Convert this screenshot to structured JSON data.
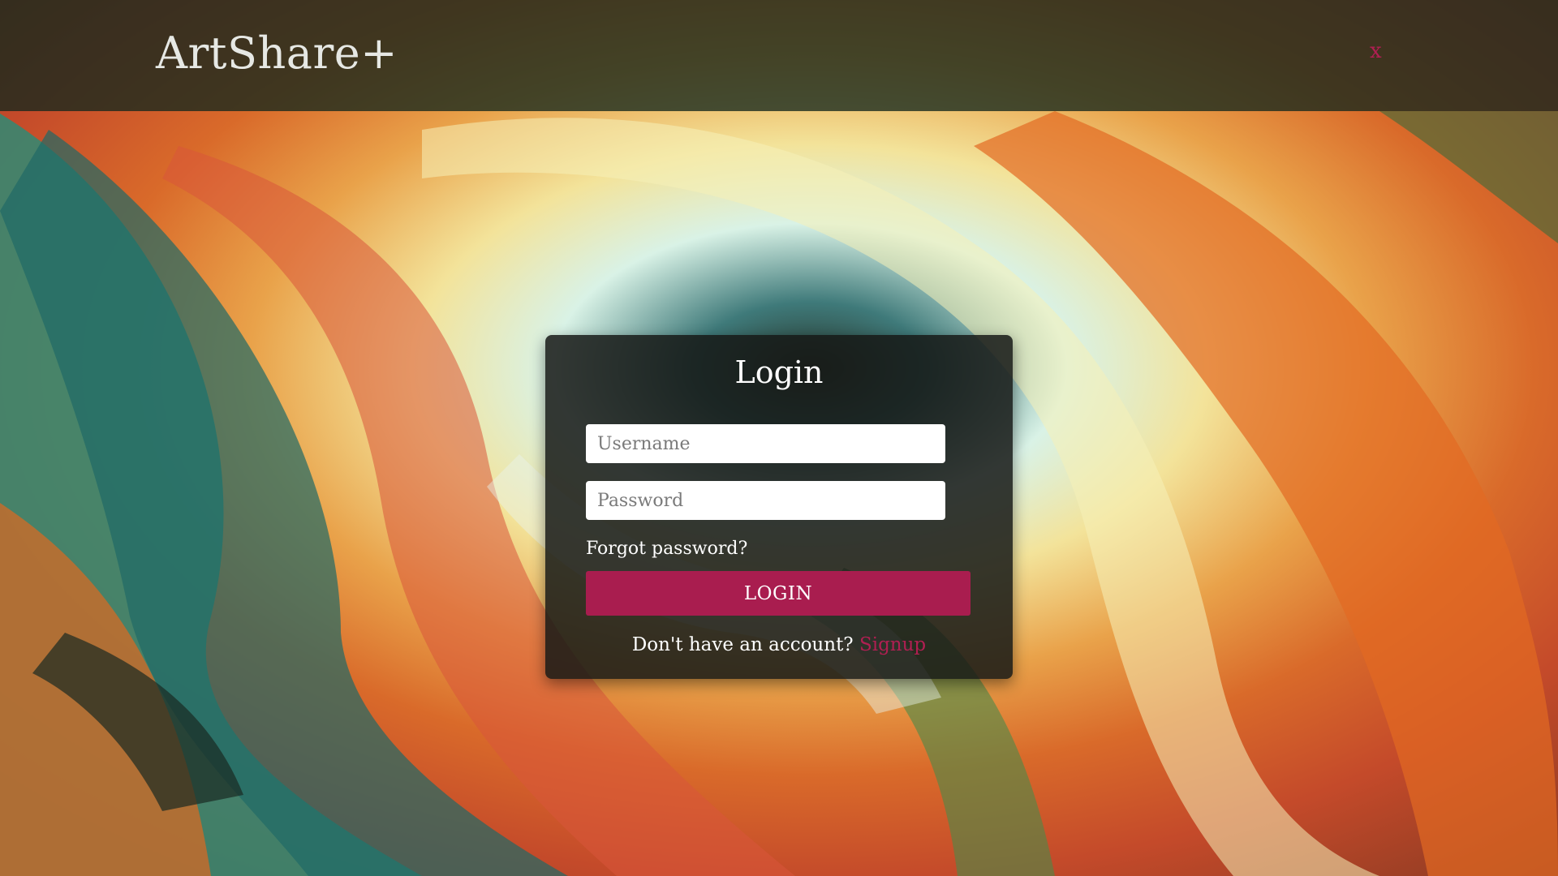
{
  "header": {
    "brand": "ArtShare+",
    "close_label": "x"
  },
  "login_card": {
    "title": "Login",
    "username_placeholder": "Username",
    "password_placeholder": "Password",
    "forgot_password": "Forgot password?",
    "login_button": "LOGIN",
    "no_account_text": "Don't have an account?",
    "signup_link": "Signup"
  },
  "colors": {
    "accent": "#a91d4f",
    "header_bg": "#14281c",
    "card_bg": "#161816"
  }
}
